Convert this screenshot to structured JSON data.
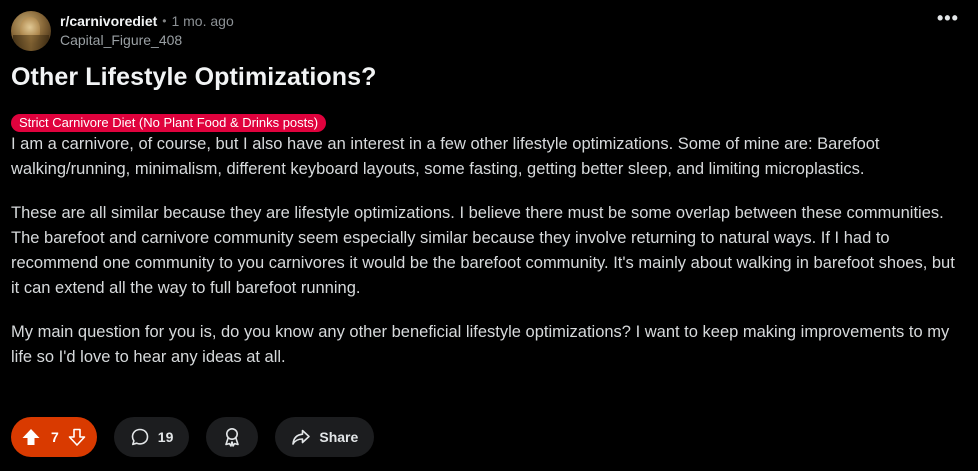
{
  "post": {
    "subreddit": "r/carnivorediet",
    "separator": "•",
    "time_ago": "1 mo. ago",
    "author": "Capital_Figure_408",
    "more_label": "•••",
    "title": "Other Lifestyle Optimizations?",
    "flair": "Strict Carnivore Diet (No Plant Food & Drinks posts)",
    "paragraphs": [
      "I am a carnivore, of course, but I also have an interest in a few other lifestyle optimizations. Some of mine are: Barefoot walking/running, minimalism, different keyboard layouts, some fasting, getting better sleep, and limiting microplastics.",
      "These are all similar because they are lifestyle optimizations. I believe there must be some overlap between these communities. The barefoot and carnivore community seem especially similar because they involve returning to natural ways. If I had to recommend one community to you carnivores it would be the barefoot community. It's mainly about walking in barefoot shoes, but it can extend all the way to full barefoot running.",
      "My main question for you is, do you know any other beneficial lifestyle optimizations? I want to keep making improvements to my life so I'd love to hear any ideas at all."
    ]
  },
  "actions": {
    "vote_count": "7",
    "comment_count": "19",
    "share_label": "Share"
  },
  "colors": {
    "background": "#000000",
    "upvoted_accent": "#d93a00",
    "flair": "#e0023d",
    "pill_bg": "#1c1d1f"
  },
  "icons": {
    "upvote": "upvote-arrow-icon",
    "downvote": "downvote-arrow-icon",
    "comment": "comment-bubble-icon",
    "award": "award-ribbon-icon",
    "share": "share-arrow-icon"
  }
}
